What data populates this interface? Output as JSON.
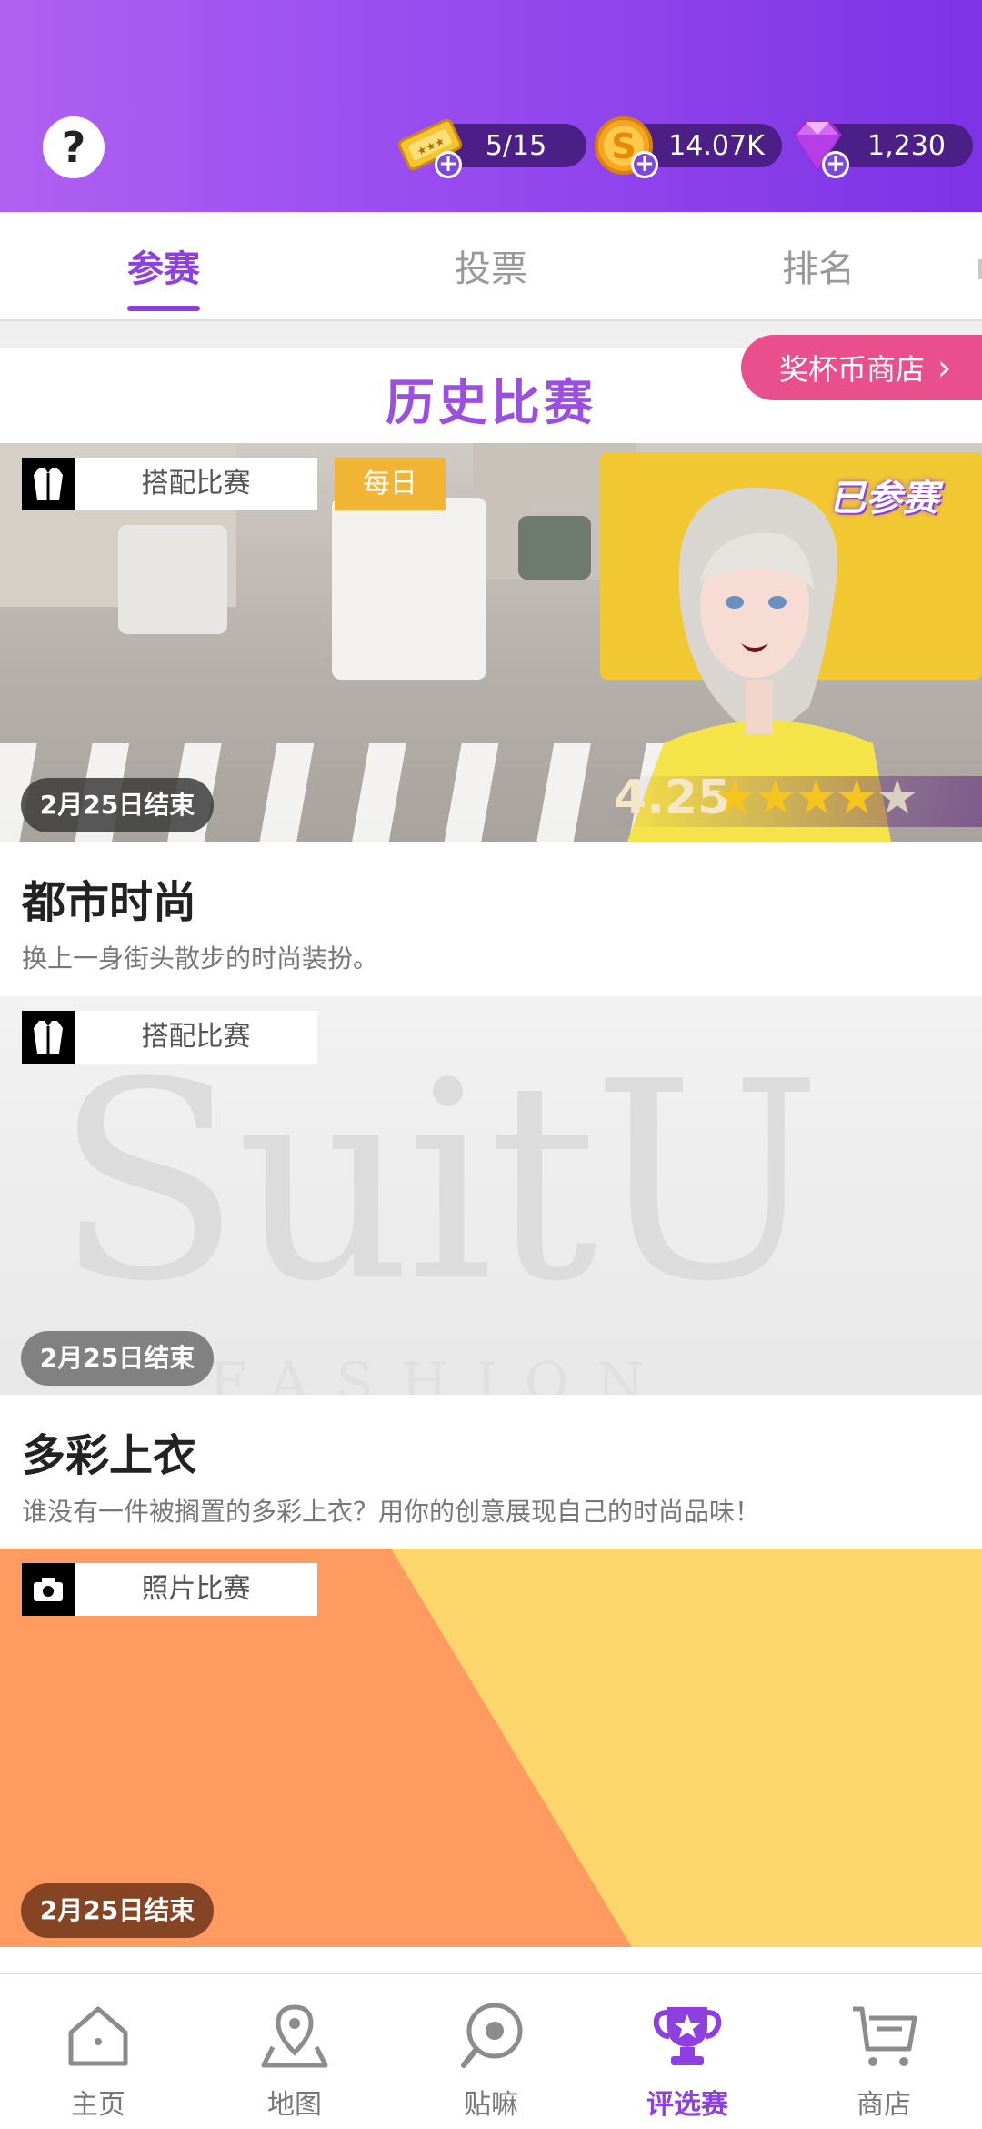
{
  "header": {
    "help_label": "?",
    "tickets": "5/15",
    "coins": "14.07K",
    "gems": "1,230"
  },
  "tabs": [
    {
      "label": "参赛",
      "active": true
    },
    {
      "label": "投票",
      "active": false
    },
    {
      "label": "排名",
      "active": false
    }
  ],
  "section": {
    "title": "历史比赛",
    "shop_button": "奖杯币商店"
  },
  "cards": [
    {
      "type": "搭配比赛",
      "badge": "每日",
      "joined": "已参赛",
      "rating": "4.25",
      "rating_value": 4.25,
      "end": "2月25日结束",
      "title": "都市时尚",
      "desc": "换上一身街头散步的时尚装扮。"
    },
    {
      "type": "搭配比赛",
      "watermark": "SuitU",
      "watermark_sub": "FASHION",
      "end": "2月25日结束",
      "title": "多彩上衣",
      "desc": "谁没有一件被搁置的多彩上衣？用你的创意展现自己的时尚品味！"
    },
    {
      "type": "照片比赛",
      "end": "2月25日结束"
    }
  ],
  "nav": [
    {
      "label": "主页",
      "icon": "home-icon"
    },
    {
      "label": "地图",
      "icon": "map-pin-icon"
    },
    {
      "label": "贴嘛",
      "icon": "chat-icon"
    },
    {
      "label": "评选赛",
      "icon": "trophy-icon",
      "active": true
    },
    {
      "label": "商店",
      "icon": "cart-icon"
    }
  ],
  "colors": {
    "accent": "#8e3fe0",
    "shop_pink": "#ea4f8d",
    "daily_gold": "#f1b435"
  }
}
